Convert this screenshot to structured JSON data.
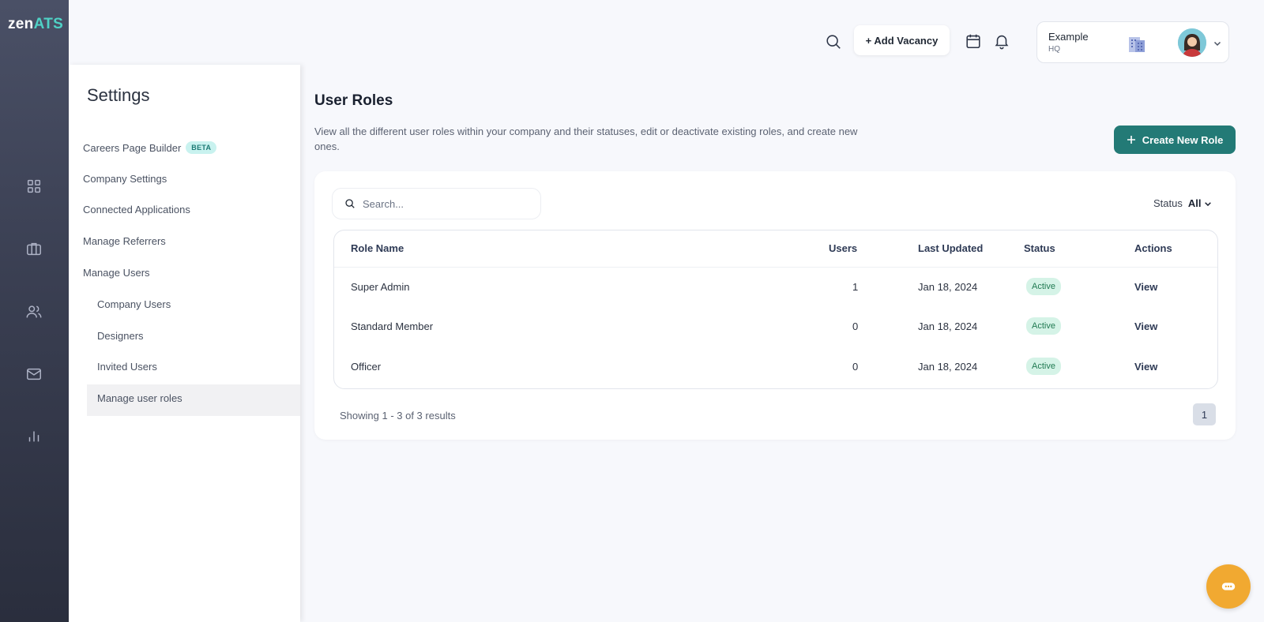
{
  "brand": {
    "prefix": "zen",
    "suffix": "ATS"
  },
  "rail": {
    "items": [
      {
        "icon": "grid-icon"
      },
      {
        "icon": "briefcase-icon"
      },
      {
        "icon": "users-icon"
      },
      {
        "icon": "mail-icon"
      },
      {
        "icon": "bar-chart-icon"
      }
    ]
  },
  "header": {
    "add_vacancy_label": "+ Add Vacancy",
    "org": {
      "name": "Example",
      "location": "HQ"
    }
  },
  "settings": {
    "title": "Settings",
    "items": [
      {
        "label": "Careers Page Builder",
        "badge": "BETA"
      },
      {
        "label": "Company Settings"
      },
      {
        "label": "Connected Applications"
      },
      {
        "label": "Manage Referrers"
      },
      {
        "label": "Manage Users"
      }
    ],
    "sub_items": [
      {
        "label": "Company Users"
      },
      {
        "label": "Designers"
      },
      {
        "label": "Invited Users"
      },
      {
        "label": "Manage user roles",
        "active": true
      }
    ]
  },
  "main": {
    "title": "User Roles",
    "description": "View all the different user roles within your company and their statuses, edit or deactivate existing roles, and create new ones.",
    "create_label": "Create New Role",
    "search_placeholder": "Search...",
    "status_filter": {
      "label": "Status",
      "value": "All"
    },
    "table": {
      "headers": [
        "Role Name",
        "Users",
        "Last Updated",
        "Status",
        "Actions"
      ],
      "rows": [
        {
          "role": "Super Admin",
          "users": "1",
          "updated": "Jan 18, 2024",
          "status": "Active",
          "action": "View"
        },
        {
          "role": "Standard Member",
          "users": "0",
          "updated": "Jan 18, 2024",
          "status": "Active",
          "action": "View"
        },
        {
          "role": "Officer",
          "users": "0",
          "updated": "Jan 18, 2024",
          "status": "Active",
          "action": "View"
        }
      ]
    },
    "showing": "Showing 1 - 3 of 3 results",
    "current_page": "1"
  },
  "colors": {
    "accent": "#237a76",
    "rail": "#3a3f52",
    "chat": "#f1a931",
    "active_badge": "#d5f3e7"
  }
}
